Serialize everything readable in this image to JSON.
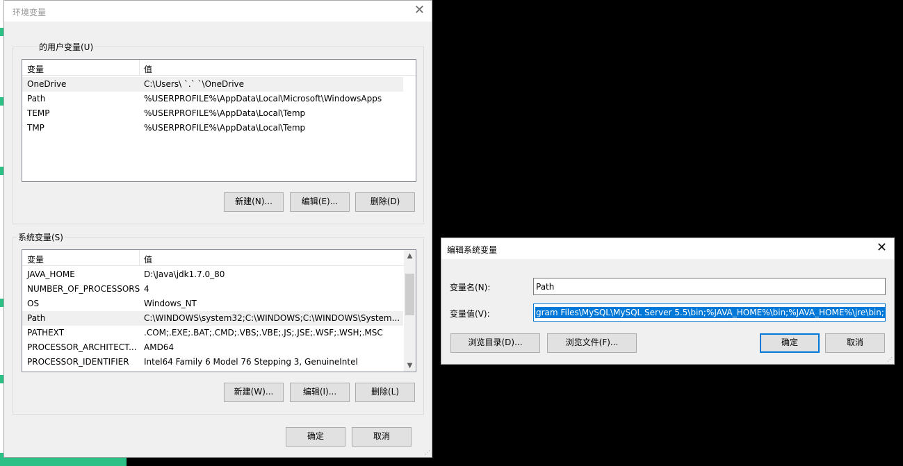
{
  "env_dialog": {
    "title": "环境变量",
    "user_group_label": "的用户变量(U)",
    "user_list": {
      "headers": [
        "变量",
        "值"
      ],
      "rows": [
        {
          "name": "OneDrive",
          "value": "C:\\Users\\  `.`  `\\OneDrive"
        },
        {
          "name": "Path",
          "value": "%USERPROFILE%\\AppData\\Local\\Microsoft\\WindowsApps"
        },
        {
          "name": "TEMP",
          "value": "%USERPROFILE%\\AppData\\Local\\Temp"
        },
        {
          "name": "TMP",
          "value": "%USERPROFILE%\\AppData\\Local\\Temp"
        }
      ]
    },
    "user_buttons": {
      "new": "新建(N)...",
      "edit": "编辑(E)...",
      "delete": "删除(D)"
    },
    "system_group_label": "系统变量(S)",
    "system_list": {
      "headers": [
        "变量",
        "值"
      ],
      "rows": [
        {
          "name": "JAVA_HOME",
          "value": "D:\\Java\\jdk1.7.0_80"
        },
        {
          "name": "NUMBER_OF_PROCESSORS",
          "value": "4"
        },
        {
          "name": "OS",
          "value": "Windows_NT"
        },
        {
          "name": "Path",
          "value": "C:\\WINDOWS\\system32;C:\\WINDOWS;C:\\WINDOWS\\System..."
        },
        {
          "name": "PATHEXT",
          "value": ".COM;.EXE;.BAT;.CMD;.VBS;.VBE;.JS;.JSE;.WSF;.WSH;.MSC"
        },
        {
          "name": "PROCESSOR_ARCHITECT...",
          "value": "AMD64"
        },
        {
          "name": "PROCESSOR_IDENTIFIER",
          "value": "Intel64 Family 6 Model 76 Stepping 3, GenuineIntel"
        }
      ]
    },
    "system_buttons": {
      "new": "新建(W)...",
      "edit": "编辑(I)...",
      "delete": "删除(L)"
    },
    "ok": "确定",
    "cancel": "取消"
  },
  "edit_dialog": {
    "title": "编辑系统变量",
    "name_label": "变量名(N):",
    "name_value": "Path",
    "value_label": "变量值(V):",
    "value_value": "gram Files\\MySQL\\MySQL Server 5.5\\bin;%JAVA_HOME%\\bin;%JAVA_HOME%\\jre\\bin;",
    "browse_dir": "浏览目录(D)...",
    "browse_file": "浏览文件(F)...",
    "ok": "确定",
    "cancel": "取消"
  }
}
